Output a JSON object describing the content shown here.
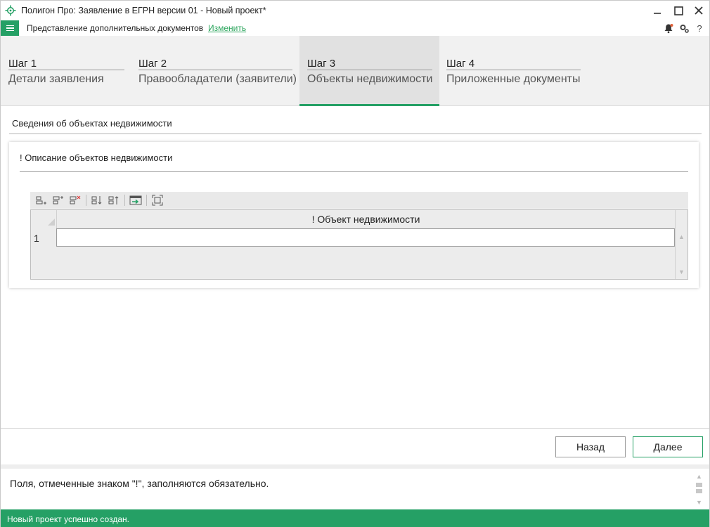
{
  "window": {
    "title": "Полигон Про: Заявление в ЕГРН версии 01 - Новый проект*"
  },
  "menubar": {
    "label": "Представление дополнительных документов",
    "link": "Изменить"
  },
  "steps": [
    {
      "num": "Шаг 1",
      "name": "Детали заявления",
      "active": false
    },
    {
      "num": "Шаг 2",
      "name": "Правообладатели (заявители)",
      "active": false
    },
    {
      "num": "Шаг 3",
      "name": "Объекты недвижимости",
      "active": true
    },
    {
      "num": "Шаг 4",
      "name": "Приложенные документы",
      "active": false
    }
  ],
  "section": {
    "title": "Сведения об объектах недвижимости"
  },
  "panel": {
    "title": "! Описание объектов недвижимости",
    "grid": {
      "column": "! Объект недвижимости",
      "rows": [
        {
          "num": "1",
          "value": ""
        }
      ]
    }
  },
  "buttons": {
    "back": "Назад",
    "next": "Далее"
  },
  "hint": {
    "text": "Поля, отмеченные знаком \"!\", заполняются обязательно."
  },
  "status": {
    "text": "Новый проект успешно создан."
  },
  "colors": {
    "accent": "#25a065",
    "link": "#2ba55c"
  }
}
